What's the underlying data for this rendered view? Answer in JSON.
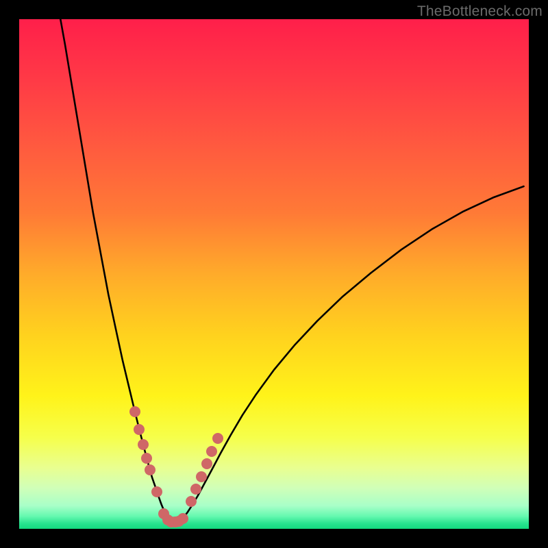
{
  "watermark": "TheBottleneck.com",
  "colors": {
    "frame_bg": "#000000",
    "watermark": "#6b6b6b",
    "curve": "#000000",
    "marker": "#cf6767",
    "gradient_stops": [
      {
        "offset": 0.0,
        "color": "#ff1f4a"
      },
      {
        "offset": 0.12,
        "color": "#ff3a46"
      },
      {
        "offset": 0.25,
        "color": "#ff5a3f"
      },
      {
        "offset": 0.38,
        "color": "#ff7a36"
      },
      {
        "offset": 0.5,
        "color": "#ffab2a"
      },
      {
        "offset": 0.62,
        "color": "#ffd21e"
      },
      {
        "offset": 0.74,
        "color": "#fff31a"
      },
      {
        "offset": 0.82,
        "color": "#f6ff4a"
      },
      {
        "offset": 0.88,
        "color": "#e9ff90"
      },
      {
        "offset": 0.92,
        "color": "#d0ffb8"
      },
      {
        "offset": 0.955,
        "color": "#a8ffc8"
      },
      {
        "offset": 0.975,
        "color": "#66f9b0"
      },
      {
        "offset": 0.99,
        "color": "#27e38e"
      },
      {
        "offset": 1.0,
        "color": "#13d97e"
      }
    ]
  },
  "chart_data": {
    "type": "line",
    "title": "",
    "xlabel": "",
    "ylabel": "",
    "xlim": [
      0,
      100
    ],
    "ylim": [
      0,
      100
    ],
    "grid": false,
    "series": [
      {
        "name": "bottleneck-curve",
        "x": [
          8.1,
          9.0,
          10.0,
          11.5,
          13.0,
          14.5,
          16.0,
          17.5,
          19.0,
          20.3,
          21.5,
          22.7,
          23.7,
          24.6,
          25.4,
          26.1,
          26.8,
          27.4,
          27.9,
          28.4,
          28.8,
          29.2,
          29.6,
          30.0,
          30.4,
          30.9,
          31.5,
          32.2,
          33.0,
          33.9,
          35.0,
          36.3,
          37.8,
          39.5,
          41.5,
          43.8,
          46.5,
          50.0,
          54.0,
          58.5,
          63.5,
          69.0,
          75.0,
          81.0,
          87.0,
          93.0,
          99.0
        ],
        "y": [
          100,
          95,
          89,
          80,
          71,
          62,
          54,
          46,
          39,
          33,
          28,
          23,
          19,
          15.5,
          12.5,
          10,
          8,
          6.2,
          4.8,
          3.6,
          2.7,
          2.0,
          1.5,
          1.2,
          1.2,
          1.3,
          1.6,
          2.2,
          3.2,
          4.6,
          6.4,
          8.8,
          11.6,
          14.8,
          18.4,
          22.3,
          26.4,
          31.2,
          36.0,
          40.8,
          45.6,
          50.2,
          54.8,
          58.8,
          62.2,
          65.0,
          67.2
        ]
      }
    ],
    "markers": {
      "name": "highlight-points",
      "x": [
        22.7,
        23.5,
        24.3,
        25.0,
        25.7,
        27.0,
        28.3,
        29.2,
        29.8,
        30.6,
        31.3,
        32.1,
        33.7,
        34.7,
        35.7,
        36.8,
        37.8,
        39.0
      ],
      "y": [
        23.0,
        19.5,
        16.5,
        13.8,
        11.5,
        7.3,
        3.0,
        1.7,
        1.3,
        1.3,
        1.5,
        2.0,
        5.4,
        7.8,
        10.2,
        12.8,
        15.2,
        17.8
      ]
    }
  }
}
